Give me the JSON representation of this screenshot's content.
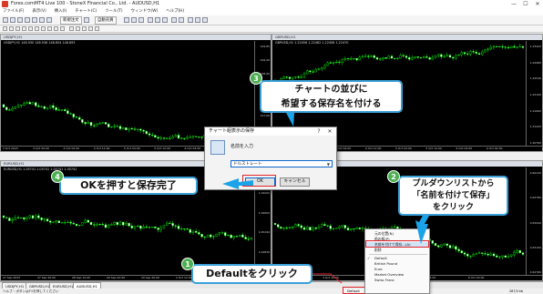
{
  "window": {
    "title": "Forex.comMT4 Live 100 - StoneX Financial Co., Ltd. - AUDUSD,H1",
    "min_glyph": "—",
    "max_glyph": "☐",
    "close_glyph": "✕"
  },
  "menu": [
    "ファイル(F)",
    "表示(V)",
    "挿入(I)",
    "チャート(C)",
    "ツール(T)",
    "ウィンドウ(W)",
    "ヘルプ(H)"
  ],
  "toolbar": {
    "new_order": "新規注文",
    "auto_trade": "自動売買"
  },
  "charts": [
    {
      "caption": "USDJPY,H1",
      "info": "USDJPY,H1  148.930 148.936 148.854 148.893",
      "price_labels": [
        "149.85",
        "149.40",
        "148.95",
        "148.50",
        "148.05",
        "147.60",
        "147.15",
        "146.70"
      ],
      "time_labels": [
        "3 Oct 2023",
        "3 Oct 20:00",
        "4 Oct 04:00",
        "4 Oct 12:00",
        "5 Oct 04:00",
        "5 Oct 12:00",
        "6 Oct 04:00",
        "9 Oct 02:00"
      ]
    },
    {
      "caption": "GBPUSD,H1",
      "info": "GBPUSD,H1  1.22456 1.22482 1.22456 1.22470",
      "price_labels": [
        "1.23420",
        "1.22980",
        "1.22540",
        "1.22100",
        "1.21660",
        "1.21220",
        "1.20780"
      ],
      "time_labels": [
        "3 Oct 2023",
        "3 Oct 20:00",
        "4 Oct 04:00",
        "4 Oct 12:00",
        "5 Oct 04:00",
        "5 Oct 12:00",
        "6 Oct 04:00",
        "9 Oct 02:00"
      ]
    },
    {
      "caption": "EURUSD,H1",
      "info": "EURUSD,H1  1.05741 1.05741 1.05741 1.05741",
      "price_labels": [
        "1.06470",
        "1.06060",
        "1.05650",
        "1.05240",
        "1.04830",
        "1.04420"
      ],
      "time_labels": [
        "27 Sep 2023",
        "27 Sep 20:00",
        "28 Sep 12:00",
        "29 Sep 04:00",
        "29 Sep 20:00",
        "2 Oct 12:00",
        "3 Oct 04:00"
      ]
    },
    {
      "caption": "AUDUSD,H1",
      "info": "AUDUSD,H1  0.63893",
      "price_labels": [
        "0.64120",
        "0.63780",
        "0.63440",
        "0.63100",
        "0.62760"
      ],
      "time_labels": [
        "3 Oct 2023",
        "3 Oct 20:00",
        "4 Oct 12:00",
        "5 Oct 04:00",
        "6 Oct 04:00"
      ]
    }
  ],
  "tabs": [
    "USDJPY,H1",
    "GBPUSD,H1",
    "EURUSD,H1",
    "AUDUSD,H1"
  ],
  "status": {
    "help_text": "ヘルプ・ボタンはF1を押してください",
    "default_label": "Default",
    "traffic": "287/3 kb"
  },
  "dialog": {
    "title": "チャート組表示の保存",
    "help_glyph": "?",
    "close_glyph": "✕",
    "name_label": "名前を入力",
    "input_value": "ドルストレート",
    "ok_label": "OK",
    "cancel_label": "キャンセル"
  },
  "context_menu": {
    "items": [
      "元の位置(N)",
      "前の組(P)",
      "名前を付けて保存...(A)",
      "削除",
      "Default",
      "British Pound",
      "Euro",
      "Market Overview",
      "Swiss Franc"
    ],
    "highlight_index": 2
  },
  "callouts": {
    "step1": {
      "number": "1",
      "text": "Defaultをクリック"
    },
    "step2": {
      "number": "2",
      "line1": "プルダウンリストから",
      "line2": "「名前を付けて保存」",
      "line3": "をクリック"
    },
    "step3": {
      "number": "3",
      "line1": "チャートの並びに",
      "line2": "希望する保存名を付ける"
    },
    "step4": {
      "number": "4",
      "text": "OKを押すと保存完了"
    }
  },
  "colors": {
    "callout_border": "#3aa0d8",
    "badge": "#4caf50",
    "arrow": "#1aa3e8",
    "highlight": "#e0252b",
    "bull_candle": "#00ff00",
    "bear_candle": "#00ff00"
  }
}
